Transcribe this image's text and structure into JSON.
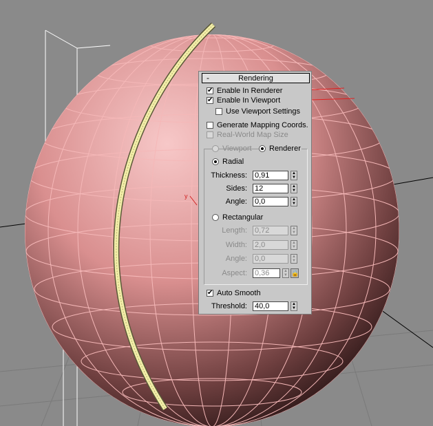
{
  "rendering_panel": {
    "collapse_symbol": "-",
    "title": "Rendering",
    "enable_in_renderer": {
      "label": "Enable In Renderer",
      "checked": true
    },
    "enable_in_viewport": {
      "label": "Enable In Viewport",
      "checked": true
    },
    "use_viewport_settings": {
      "label": "Use Viewport Settings",
      "checked": false
    },
    "generate_mapping_coords": {
      "label": "Generate Mapping Coords.",
      "checked": false
    },
    "real_world_map_size": {
      "label": "Real-World Map Size",
      "checked": false
    },
    "mode_viewport": {
      "label": "Viewport",
      "selected": false
    },
    "mode_renderer": {
      "label": "Renderer",
      "selected": true
    },
    "radial": {
      "label": "Radial",
      "selected": true,
      "thickness": {
        "label": "Thickness:",
        "value": "0,91"
      },
      "sides": {
        "label": "Sides:",
        "value": "12"
      },
      "angle": {
        "label": "Angle:",
        "value": "0,0"
      }
    },
    "rectangular": {
      "label": "Rectangular",
      "selected": false,
      "length": {
        "label": "Length:",
        "value": "0,72"
      },
      "width": {
        "label": "Width:",
        "value": "2,0"
      },
      "angle": {
        "label": "Angle:",
        "value": "0,0"
      },
      "aspect": {
        "label": "Aspect:",
        "value": "0,36"
      }
    },
    "auto_smooth": {
      "label": "Auto Smooth",
      "checked": true
    },
    "threshold": {
      "label": "Threshold:",
      "value": "40,0"
    }
  },
  "viewport": {
    "axis_label": "y",
    "colors": {
      "background": "#8a8a8a",
      "sphere": "#e6a0a0",
      "wire": "#f5b8b8",
      "spline": "#f2eea8",
      "annotation": "#e02020"
    }
  }
}
